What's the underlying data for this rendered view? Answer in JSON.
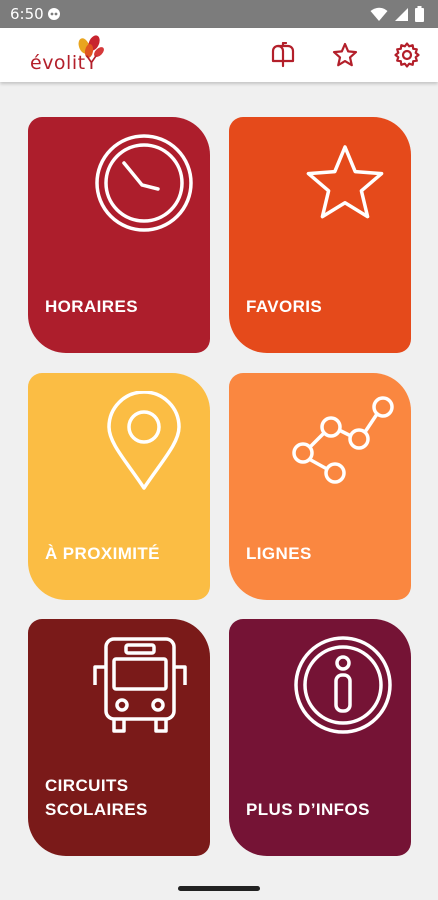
{
  "status_bar": {
    "time": "6:50"
  },
  "app": {
    "logo_text": "évolitY",
    "colors": {
      "brand": "#b31f2a"
    }
  },
  "toolbar": {
    "icons": [
      "mailbox-icon",
      "star-icon",
      "gear-icon"
    ]
  },
  "tiles": [
    {
      "label": "HORAIRES",
      "icon": "clock-icon",
      "color": "#ad1e2c"
    },
    {
      "label": "FAVORIS",
      "icon": "star-icon",
      "color": "#e54a1b"
    },
    {
      "label": "À PROXIMITÉ",
      "icon": "location-pin-icon",
      "color": "#fbbd44"
    },
    {
      "label": "LIGNES",
      "icon": "route-nodes-icon",
      "color": "#fa8740"
    },
    {
      "label": "CIRCUITS\nSCOLAIRES",
      "icon": "bus-icon",
      "color": "#7a1a19"
    },
    {
      "label": "PLUS D’INFOS",
      "icon": "info-icon",
      "color": "#751335"
    }
  ]
}
